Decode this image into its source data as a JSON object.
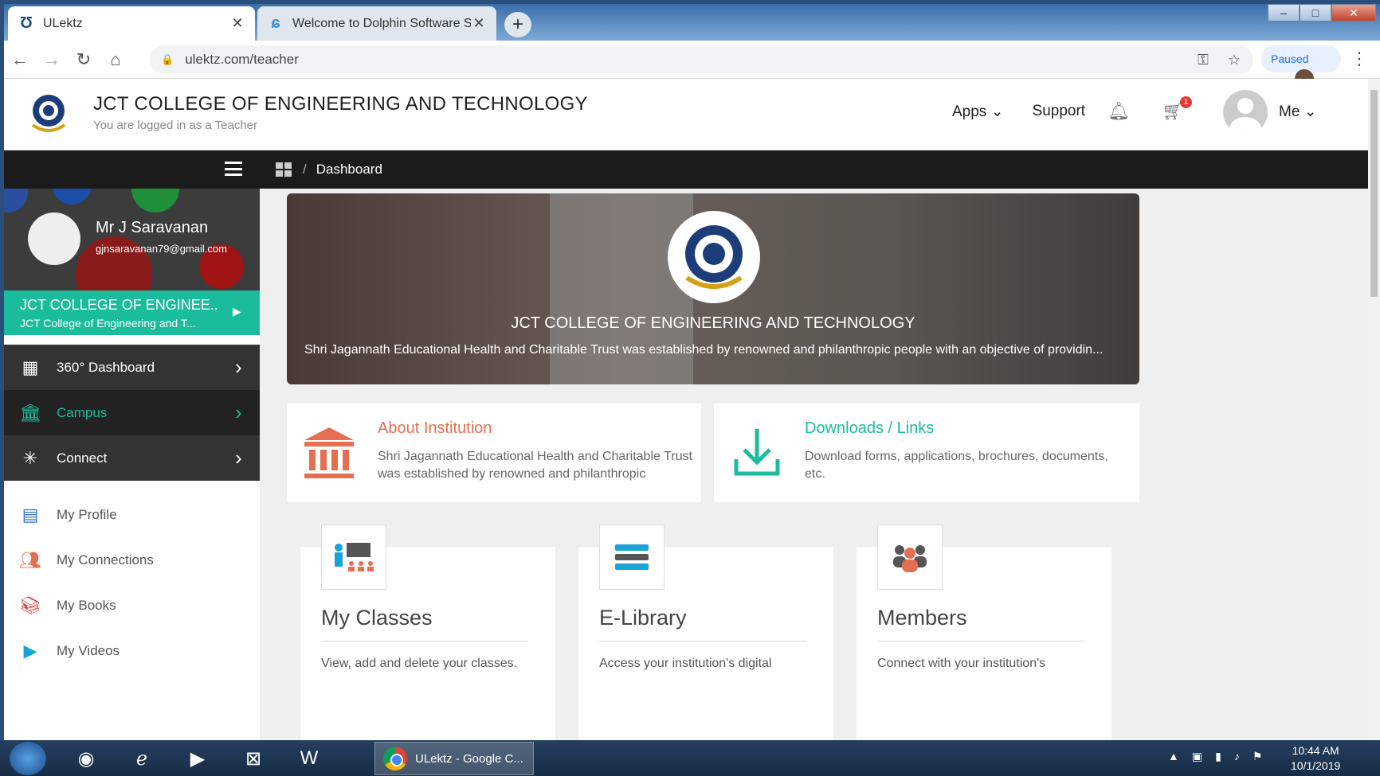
{
  "browser": {
    "tabs": [
      {
        "title": "ULektz",
        "icon": "ulektz-icon",
        "active": true
      },
      {
        "title": "Welcome to Dolphin Software So",
        "icon": "dolphin-icon",
        "active": false
      }
    ],
    "new_tab": "+",
    "url": "ulektz.com/teacher",
    "paused_label": "Paused",
    "window_controls": [
      "–",
      "□",
      "✕"
    ]
  },
  "header": {
    "title": "JCT COLLEGE OF ENGINEERING AND TECHNOLOGY",
    "subtitle": "You are logged in as a Teacher",
    "nav": {
      "apps": "Apps",
      "support": "Support",
      "cart_count": "1",
      "me": "Me"
    }
  },
  "sidebar": {
    "user_name": "Mr J Saravanan",
    "user_email": "gjnsaravanan79@gmail.com",
    "institution_short": "JCT COLLEGE OF ENGINEE...",
    "institution_full": "JCT College of Engineering and T...",
    "menu": [
      {
        "label": "360° Dashboard",
        "icon": "dashboard-icon"
      },
      {
        "label": "Campus",
        "icon": "campus-icon"
      },
      {
        "label": "Connect",
        "icon": "connect-icon"
      }
    ],
    "links": [
      {
        "label": "My Profile",
        "icon": "profile-icon"
      },
      {
        "label": "My Connections",
        "icon": "connections-icon"
      },
      {
        "label": "My Books",
        "icon": "books-icon"
      },
      {
        "label": "My Videos",
        "icon": "videos-icon"
      }
    ]
  },
  "breadcrumb": {
    "separator": "/",
    "current": "Dashboard"
  },
  "banner": {
    "title": "JCT COLLEGE OF ENGINEERING AND TECHNOLOGY",
    "description": "Shri Jagannath Educational Health and Charitable Trust was established by renowned and philanthropic people with an objective of providin..."
  },
  "cards": [
    {
      "title": "About Institution",
      "description": "Shri Jagannath Educational Health and Charitable Trust was established by renowned and philanthropic",
      "color": "#e76f51"
    },
    {
      "title": "Downloads / Links",
      "description": "Download forms, applications, brochures, documents, etc.",
      "color": "#1bbc9b"
    }
  ],
  "tiles": [
    {
      "title": "My Classes",
      "description": "View, add and delete your classes."
    },
    {
      "title": "E-Library",
      "description": "Access your institution's digital"
    },
    {
      "title": "Members",
      "description": "Connect with your institution's"
    }
  ],
  "taskbar": {
    "app_label": "ULektz - Google C...",
    "time": "10:44 AM",
    "date": "10/1/2019"
  },
  "colors": {
    "accent": "#1bbc9b",
    "orange": "#e76f51",
    "dark": "#1b1b1b"
  }
}
